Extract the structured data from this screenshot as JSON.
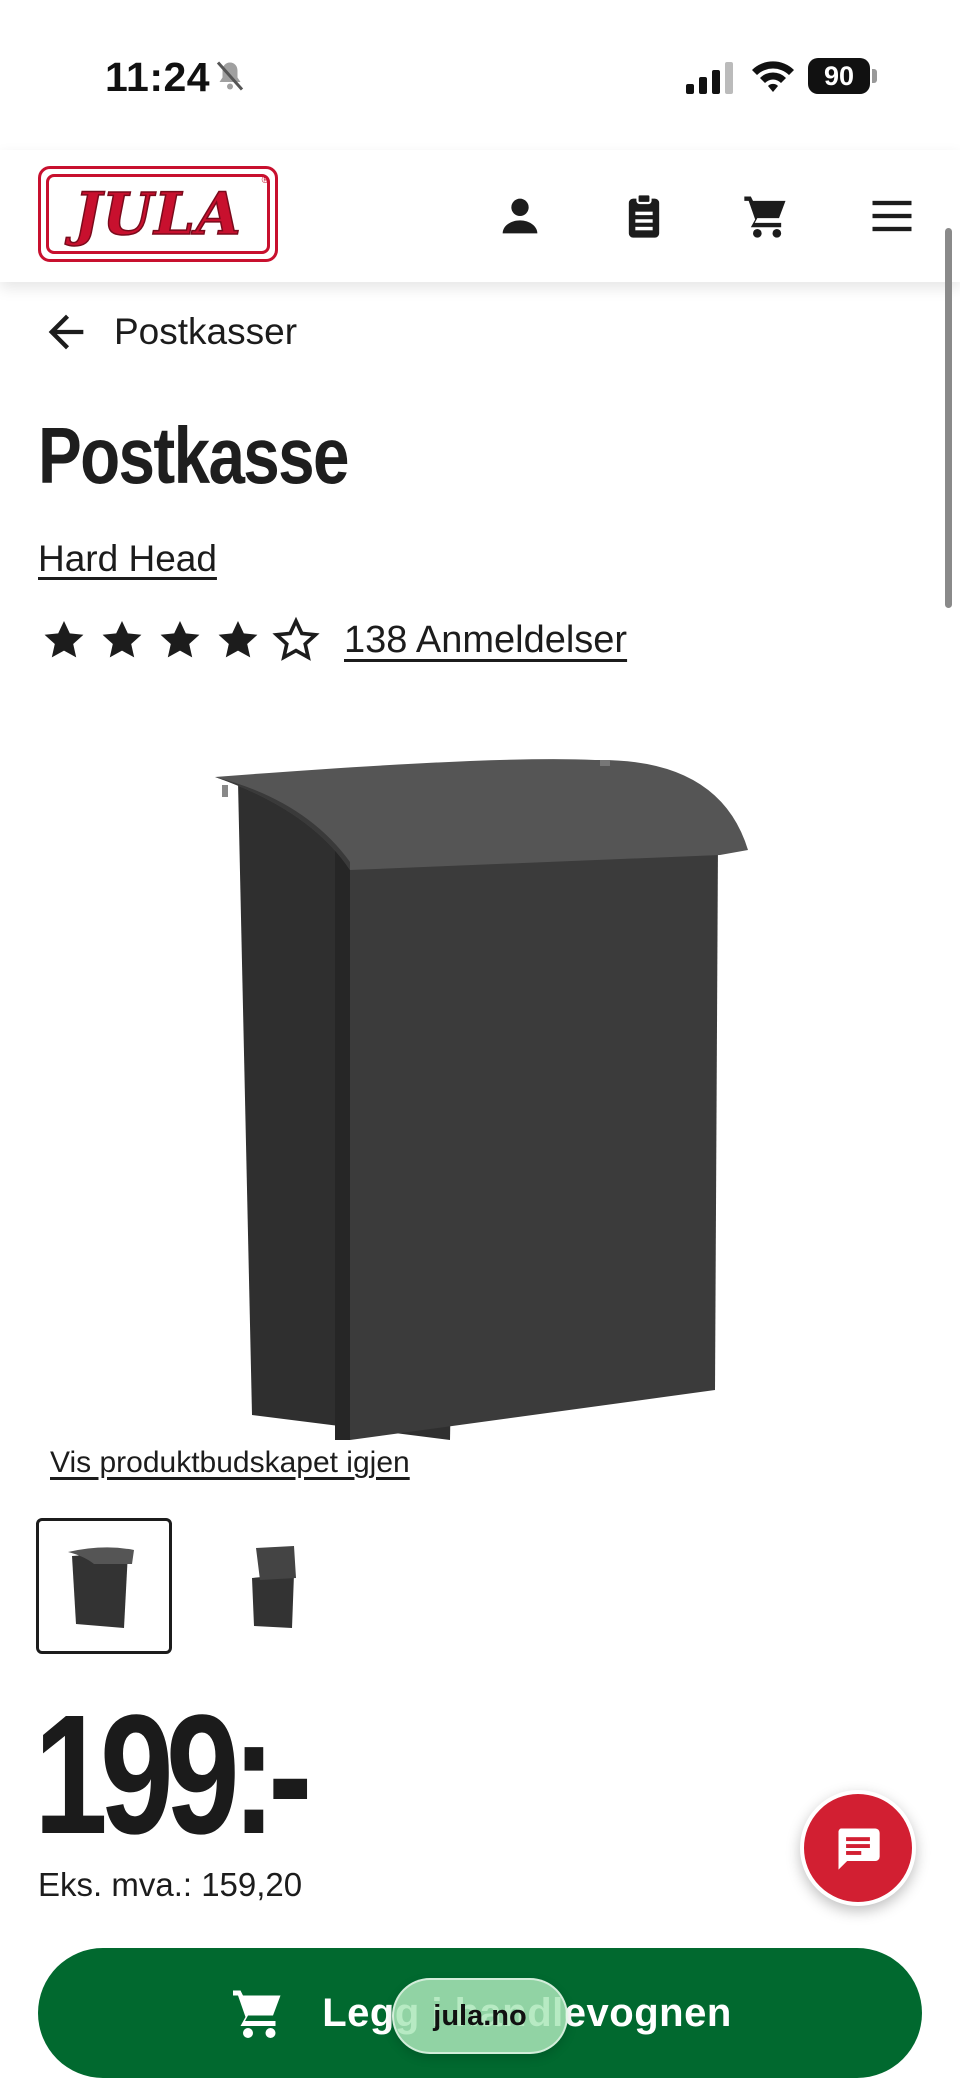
{
  "status_bar": {
    "time": "11:24",
    "battery": "90"
  },
  "header": {
    "logo_text": "JULA"
  },
  "breadcrumb": {
    "label": "Postkasser"
  },
  "product": {
    "title": "Postkasse",
    "brand": "Hard Head",
    "rating": 4,
    "rating_max": 5,
    "reviews_label": "138 Anmeldelser",
    "restore_label": "Vis produktbudskapet igjen",
    "price": "199:-",
    "price_ex_vat": "Eks. mva.: 159,20"
  },
  "actions": {
    "add_to_cart_label": "Legg i handlevognen"
  },
  "browser": {
    "url": "jula.no"
  },
  "colors": {
    "brand_red": "#c8102e",
    "cart_green": "#01692f",
    "chat_red": "#d21f32"
  },
  "icons": [
    "bell-muted-icon",
    "signal-icon",
    "wifi-icon",
    "battery-icon",
    "user-icon",
    "clipboard-icon",
    "cart-icon",
    "menu-icon",
    "back-arrow-icon",
    "star-icon",
    "chat-icon"
  ]
}
